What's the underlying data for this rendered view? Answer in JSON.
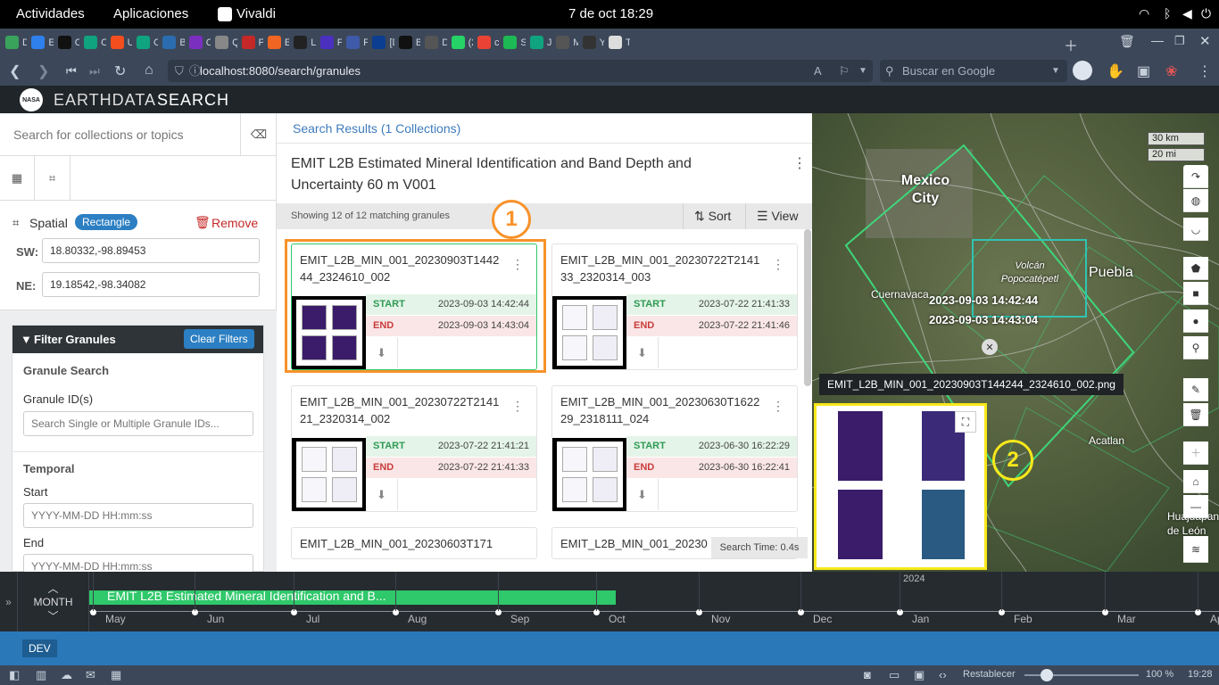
{
  "system": {
    "activities": "Actividades",
    "applications": "Aplicaciones",
    "app": "Vivaldi",
    "clock": "7 de oct  18:29"
  },
  "tabs": [
    {
      "label": "Da",
      "color": "#3aa35b"
    },
    {
      "label": "Es",
      "color": "#2f80ed"
    },
    {
      "label": "Ol",
      "color": "#111"
    },
    {
      "label": "Ol",
      "color": "#10a37f"
    },
    {
      "label": "Ur",
      "color": "#f24e1e"
    },
    {
      "label": "Cr",
      "color": "#10a37f"
    },
    {
      "label": "Bo",
      "color": "#2b6cb0"
    },
    {
      "label": "Ca",
      "color": "#7b2fbf"
    },
    {
      "label": "Qu",
      "color": "#888"
    },
    {
      "label": "Pe",
      "color": "#c62828"
    },
    {
      "label": "Es",
      "color": "#f06522"
    },
    {
      "label": "Lo",
      "color": "#222"
    },
    {
      "label": "Pi",
      "color": "#4b2fbf"
    },
    {
      "label": "Fi",
      "color": "#3f5aa8"
    },
    {
      "label": "[D",
      "color": "#0b3d91"
    },
    {
      "label": "Bo",
      "color": "#111"
    },
    {
      "label": "Dc",
      "color": "#555"
    },
    {
      "label": "(2",
      "color": "#25d366"
    },
    {
      "label": "co",
      "color": "#ea4335"
    },
    {
      "label": "Sp",
      "color": "#1db954"
    },
    {
      "label": "JD",
      "color": "#10a37f"
    },
    {
      "label": "Mi",
      "color": "#555"
    },
    {
      "label": "Yo",
      "color": "#333"
    },
    {
      "label": "Tr",
      "color": "#ddd"
    }
  ],
  "address": {
    "url": "localhost:8080/search/granules",
    "search_placeholder": "Buscar en Google"
  },
  "header": {
    "brand_light": "EARTHDATA",
    "brand_bold": "SEARCH",
    "nasa": "NASA"
  },
  "left": {
    "search_placeholder": "Search for collections or topics",
    "spatial_label": "Spatial",
    "spatial_badge": "Rectangle",
    "remove": "Remove",
    "sw_label": "SW:",
    "sw_value": "18.80332,-98.89453",
    "ne_label": "NE:",
    "ne_value": "19.18542,-98.34082",
    "filter_title": "Filter Granules",
    "clear_filters": "Clear Filters",
    "granule_search": "Granule Search",
    "granule_ids": "Granule ID(s)",
    "granule_placeholder": "Search Single or Multiple Granule IDs...",
    "temporal": "Temporal",
    "start": "Start",
    "start_placeholder": "YYYY-MM-DD HH:mm:ss",
    "end": "End",
    "end_placeholder": "YYYY-MM-DD HH:mm:ss"
  },
  "results": {
    "breadcrumb": "Search Results (1 Collections)",
    "collection_title": "EMIT L2B Estimated Mineral Identification and Band Depth and Uncertainty 60 m V001",
    "showing": "Showing 12 of 12 matching granules",
    "sort": "Sort",
    "view": "View",
    "search_time": "Search Time: 0.4s",
    "annotation_1": "1",
    "annotation_2": "2",
    "start_label": "START",
    "end_label": "END",
    "cards": [
      {
        "id": "EMIT_L2B_MIN_001_20230903T144244_2324610_002",
        "start": "2023-09-03 14:42:44",
        "end": "2023-09-03 14:43:04"
      },
      {
        "id": "EMIT_L2B_MIN_001_20230722T214133_2320314_003",
        "start": "2023-07-22 21:41:33",
        "end": "2023-07-22 21:41:46"
      },
      {
        "id": "EMIT_L2B_MIN_001_20230722T214121_2320314_002",
        "start": "2023-07-22 21:41:21",
        "end": "2023-07-22 21:41:33"
      },
      {
        "id": "EMIT_L2B_MIN_001_20230630T162229_2318111_024",
        "start": "2023-06-30 16:22:29",
        "end": "2023-06-30 16:22:41"
      },
      {
        "id": "EMIT_L2B_MIN_001_20230603T171",
        "start": "",
        "end": ""
      },
      {
        "id": "EMIT_L2B_MIN_001_20230",
        "start": "",
        "end": ""
      }
    ]
  },
  "map": {
    "scale_km": "30 km",
    "scale_mi": "20 mi",
    "city_mexico": "Mexico City",
    "city_puebla": "Puebla",
    "city_cuernavaca": "Cuernavaca",
    "volcano": "Volcán Popocatépetl",
    "city_acatlan": "Acatlan",
    "city_huajuapan": "Huajuapan de León",
    "granule_start": "2023-09-03 14:42:44",
    "granule_end": "2023-09-03 14:43:04",
    "tooltip": "EMIT_L2B_MIN_001_20230903T144244_2324610_002.png"
  },
  "timeline": {
    "resolution": "MONTH",
    "bar_label": "EMIT L2B Estimated Mineral Identification and B...",
    "year": "2024",
    "months": [
      "May",
      "Jun",
      "Jul",
      "Aug",
      "Sep",
      "Oct",
      "Nov",
      "Dec",
      "Jan",
      "Feb",
      "Mar",
      "Apr"
    ]
  },
  "dev": "DEV",
  "status": {
    "reset": "Restablecer",
    "zoom": "100 %",
    "time": "19:28"
  }
}
